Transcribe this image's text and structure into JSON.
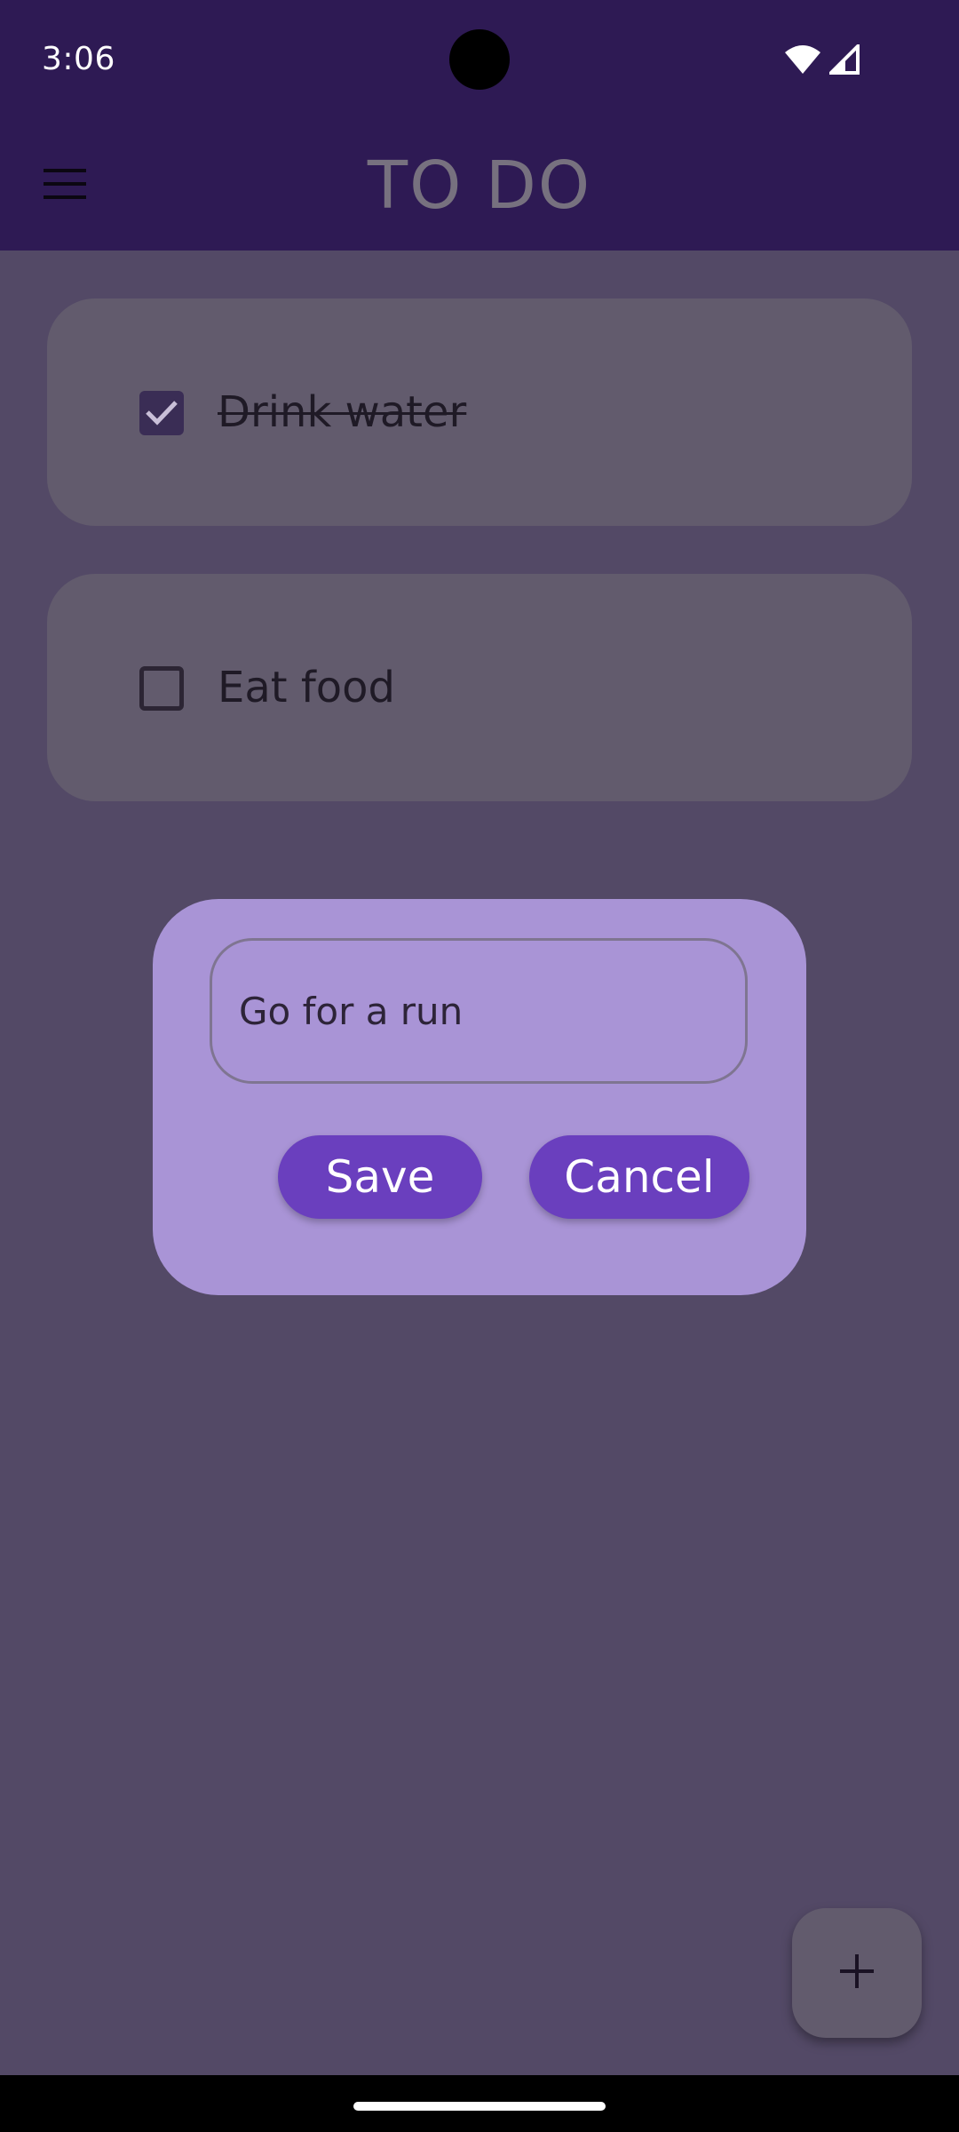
{
  "status_bar": {
    "time": "3:06",
    "icons": [
      "wifi-icon",
      "signal-icon"
    ]
  },
  "app_bar": {
    "title": "TO DO",
    "menu_icon": "hamburger-menu-icon"
  },
  "todos": [
    {
      "label": "Drink water",
      "checked": true
    },
    {
      "label": "Eat food",
      "checked": false
    }
  ],
  "dialog": {
    "input_value": "Go for a run",
    "save_label": "Save",
    "cancel_label": "Cancel"
  },
  "fab": {
    "icon": "plus-icon"
  },
  "colors": {
    "app_bar": "#2e1a54",
    "scrim_background": "#534966",
    "card": "#625b6d",
    "dialog": "#a994d6",
    "button": "#6a3fbe"
  }
}
